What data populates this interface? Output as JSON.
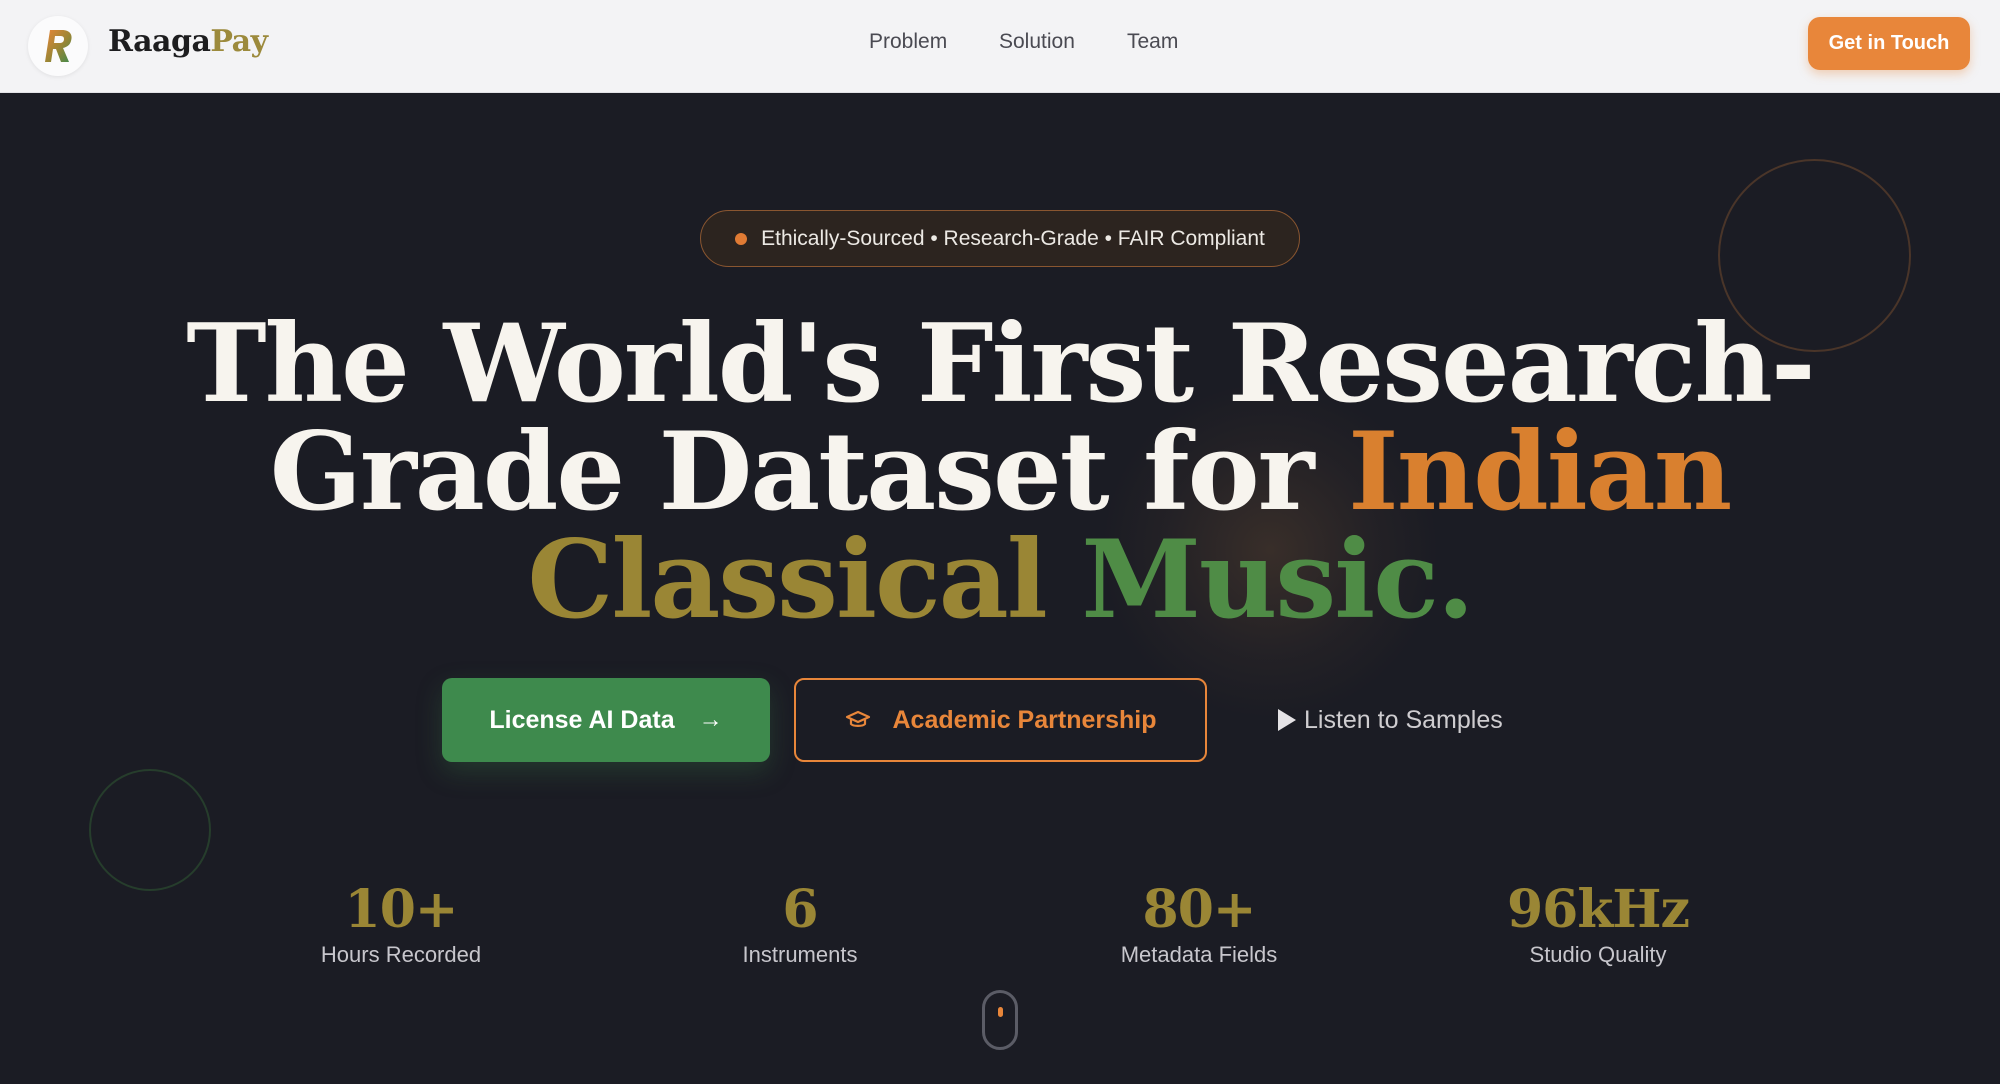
{
  "header": {
    "brand_part1": "Raaga",
    "brand_part2": "Pay",
    "logo_letter": "R",
    "nav": [
      {
        "label": "Problem"
      },
      {
        "label": "Solution"
      },
      {
        "label": "Team"
      }
    ],
    "cta_label": "Get in Touch"
  },
  "hero": {
    "pill_text": "Ethically-Sourced • Research-Grade • FAIR Compliant",
    "headline": {
      "line1": "The World's First Research-",
      "line2_plain": "Grade Dataset for ",
      "line2_accent": "Indian",
      "line3_part1": "Classical ",
      "line3_part2": "Music."
    },
    "buttons": {
      "license": "License AI Data",
      "academic": "Academic Partnership",
      "listen": "Listen to Samples"
    },
    "stats": [
      {
        "value": "10+",
        "label": "Hours Recorded"
      },
      {
        "value": "6",
        "label": "Instruments"
      },
      {
        "value": "80+",
        "label": "Metadata Fields"
      },
      {
        "value": "96kHz",
        "label": "Studio Quality"
      }
    ]
  },
  "colors": {
    "accent_orange": "#e8863a",
    "accent_green": "#3e8a4d",
    "accent_olive": "#9a8635",
    "background": "#1b1c24"
  },
  "icons": {
    "arrow": "arrow-right-icon",
    "cap": "graduation-cap-icon",
    "play": "play-icon",
    "scroll": "mouse-scroll-icon"
  }
}
